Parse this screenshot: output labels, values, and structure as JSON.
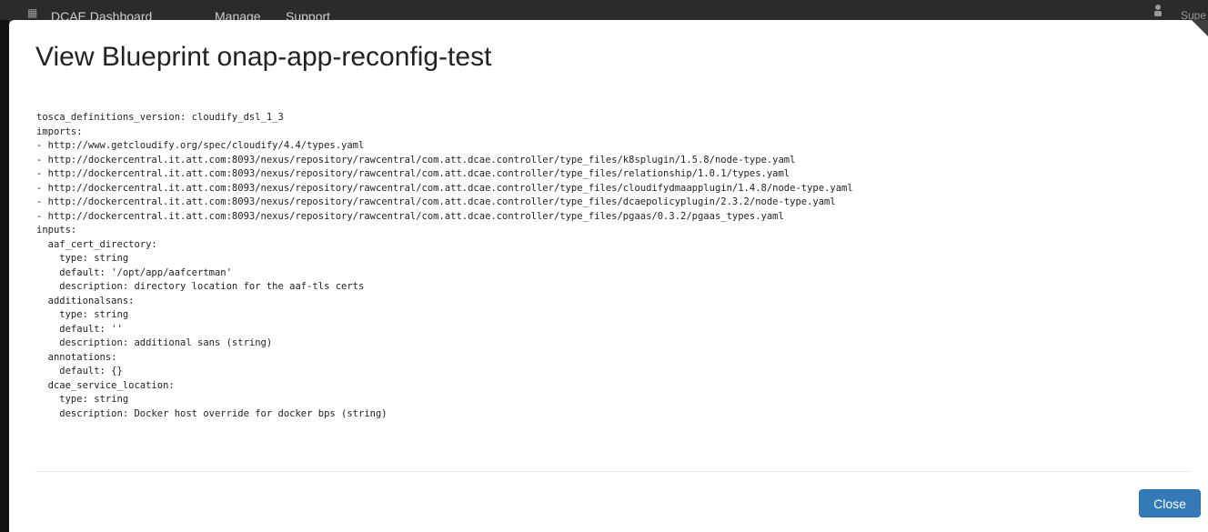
{
  "navbar": {
    "brand": "DCAE Dashboard",
    "items": [
      "Manage",
      "Support"
    ],
    "user_label": "Supe"
  },
  "modal": {
    "title": "View Blueprint onap-app-reconfig-test",
    "blueprint_lines": [
      "tosca_definitions_version: cloudify_dsl_1_3",
      "imports:",
      "- http://www.getcloudify.org/spec/cloudify/4.4/types.yaml",
      "- http://dockercentral.it.att.com:8093/nexus/repository/rawcentral/com.att.dcae.controller/type_files/k8splugin/1.5.8/node-type.yaml",
      "- http://dockercentral.it.att.com:8093/nexus/repository/rawcentral/com.att.dcae.controller/type_files/relationship/1.0.1/types.yaml",
      "- http://dockercentral.it.att.com:8093/nexus/repository/rawcentral/com.att.dcae.controller/type_files/cloudifydmaapplugin/1.4.8/node-type.yaml",
      "- http://dockercentral.it.att.com:8093/nexus/repository/rawcentral/com.att.dcae.controller/type_files/dcaepolicyplugin/2.3.2/node-type.yaml",
      "- http://dockercentral.it.att.com:8093/nexus/repository/rawcentral/com.att.dcae.controller/type_files/pgaas/0.3.2/pgaas_types.yaml",
      "inputs:",
      "  aaf_cert_directory:",
      "    type: string",
      "    default: '/opt/app/aafcertman'",
      "    description: directory location for the aaf-tls certs",
      "  additionalsans:",
      "    type: string",
      "    default: ''",
      "    description: additional sans (string)",
      "  annotations:",
      "    default: {}",
      "  dcae_service_location:",
      "    type: string",
      "    description: Docker host override for docker bps (string)"
    ],
    "close_label": "Close"
  },
  "colors": {
    "primary": "#337ab7",
    "navbar_bg": "#2b2b2b"
  }
}
